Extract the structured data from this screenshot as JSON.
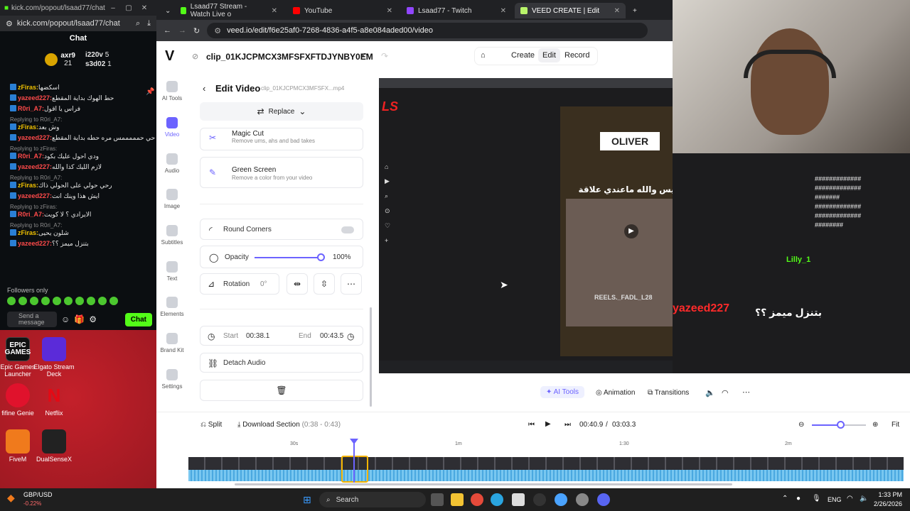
{
  "kick": {
    "title_url": "kick.com/popout/lsaad77/chat",
    "addr_url": "kick.com/popout/lsaad77/chat",
    "header": "Chat",
    "gifters": [
      {
        "name": "axr9",
        "count": "21"
      },
      {
        "name": "i220v",
        "count": "5"
      },
      {
        "name": "s3d02",
        "count": "1"
      }
    ],
    "messages": [
      {
        "reply": "",
        "user": "zFiras:",
        "text": "اسكضها",
        "color": "#f2c200"
      },
      {
        "reply": "",
        "user": "yazeed227:",
        "text": "حط الهوك بداية المقطع",
        "color": "#ff4a4a"
      },
      {
        "reply": "",
        "user": "R0ri_A7:",
        "text": "فراس يا اقول",
        "color": "#ff4a4a"
      },
      {
        "reply": "Replying to R0ri_A7:",
        "user": "zFiras:",
        "text": "وش بعد",
        "color": "#f2c200"
      },
      {
        "reply": "",
        "user": "yazeed227:",
        "text": "يحي حي حمممممس مره حطه بداية المقطع",
        "color": "#ff4a4a"
      },
      {
        "reply": "Replying to zFiras:",
        "user": "R0ri_A7:",
        "text": "ودي احول عليك بكود",
        "color": "#ff4a4a"
      },
      {
        "reply": "",
        "user": "yazeed227:",
        "text": "لازم الليك كذا والله",
        "color": "#ff4a4a"
      },
      {
        "reply": "Replying to R0ri_A7:",
        "user": "zFiras:",
        "text": "رحي حولي على الحولي ذاك",
        "color": "#f2c200"
      },
      {
        "reply": "",
        "user": "yazeed227:",
        "text": "ايش هذا وينك انت",
        "color": "#ff4a4a"
      },
      {
        "reply": "Replying to zFiras:",
        "user": "R0ri_A7:",
        "text": "الايرادي ؟ لا كويت",
        "color": "#ff4a4a"
      },
      {
        "reply": "Replying to R0ri_A7:",
        "user": "zFiras:",
        "text": "شلون يحيى",
        "color": "#f2c200"
      },
      {
        "reply": "",
        "user": "yazeed227:",
        "text": "بتنزل ميمز ؟؟",
        "color": "#ff4a4a"
      }
    ],
    "followers_only": "Followers only",
    "send_placeholder": "Send a message",
    "chat_button": "Chat"
  },
  "desktop_icons": [
    {
      "label": "Epic Games Launcher",
      "logo": "EPIC GAMES",
      "color": "#111111"
    },
    {
      "label": "Elgato Stream Deck",
      "logo": "",
      "color": "#5b2bd9"
    },
    {
      "label": "fifine Genie",
      "logo": "",
      "color": "#e0122c"
    },
    {
      "label": "Netflix",
      "logo": "N",
      "color": "#000000"
    },
    {
      "label": "FiveM",
      "logo": "",
      "color": "#f07a1c"
    },
    {
      "label": "DualSenseX",
      "logo": "",
      "color": "#222222"
    }
  ],
  "browser": {
    "tabs": [
      {
        "label": "Lsaad77 Stream - Watch Live o",
        "color": "#53fc18",
        "active": false
      },
      {
        "label": "YouTube",
        "color": "#ff0000",
        "active": false
      },
      {
        "label": "Lsaad77 - Twitch",
        "color": "#9146ff",
        "active": false
      },
      {
        "label": "VEED CREATE | Edit",
        "color": "#b8f36a",
        "active": true
      }
    ],
    "url": "veed.io/edit/f6e25af0-7268-4836-a4f5-a8e084aded00/video"
  },
  "veed": {
    "logo": "V",
    "project_title": "clip_01KJCPMCX3MFSFXFTDJYNBY0EM",
    "nav": [
      "Create",
      "Edit",
      "Record"
    ],
    "sidebar": [
      "AI Tools",
      "Video",
      "Audio",
      "Image",
      "Subtitles",
      "Text",
      "Elements",
      "Brand Kit",
      "Settings"
    ],
    "panel": {
      "title": "Edit Video",
      "filename": "clip_01KJCPMCX3MFSFX...mp4",
      "replace": "Replace",
      "magic_cut_title": "Magic Cut",
      "magic_cut_desc": "Remove ums, ahs and bad takes",
      "green_title": "Green Screen",
      "green_desc": "Remove a color from your video",
      "round_corners": "Round Corners",
      "opacity_label": "Opacity",
      "opacity_value": "100%",
      "rotation_label": "Rotation",
      "rotation_value": "0°",
      "start_label": "Start",
      "start_value": "00:38.1",
      "end_label": "End",
      "end_value": "00:43.5",
      "detach": "Detach Audio"
    },
    "preview_tools": [
      "AI Tools",
      "Animation",
      "Transitions"
    ],
    "timeline": {
      "split": "Split",
      "download": "Download Section",
      "range": "(0:38 - 0:43)",
      "current": "00:40.9",
      "sep": "/",
      "total": "03:03.3",
      "fit": "Fit",
      "ticks": [
        "30s",
        "1m",
        "1:30",
        "2m"
      ]
    }
  },
  "preview_overlay": {
    "oliver": "OLIVER",
    "caption": "ابليس والله ماعندي علاقة",
    "reel": "REELS._FADL_L28",
    "chat_user": "yazeed227",
    "chat_text": "بتنزل ميمز ؟؟",
    "lily": "Lilly_1"
  },
  "taskbar": {
    "ticker_name": "GBP/USD",
    "ticker_value": "-0.22%",
    "search": "Search",
    "lang": "ENG",
    "time": "1:33 PM",
    "date": "2/26/2026"
  }
}
